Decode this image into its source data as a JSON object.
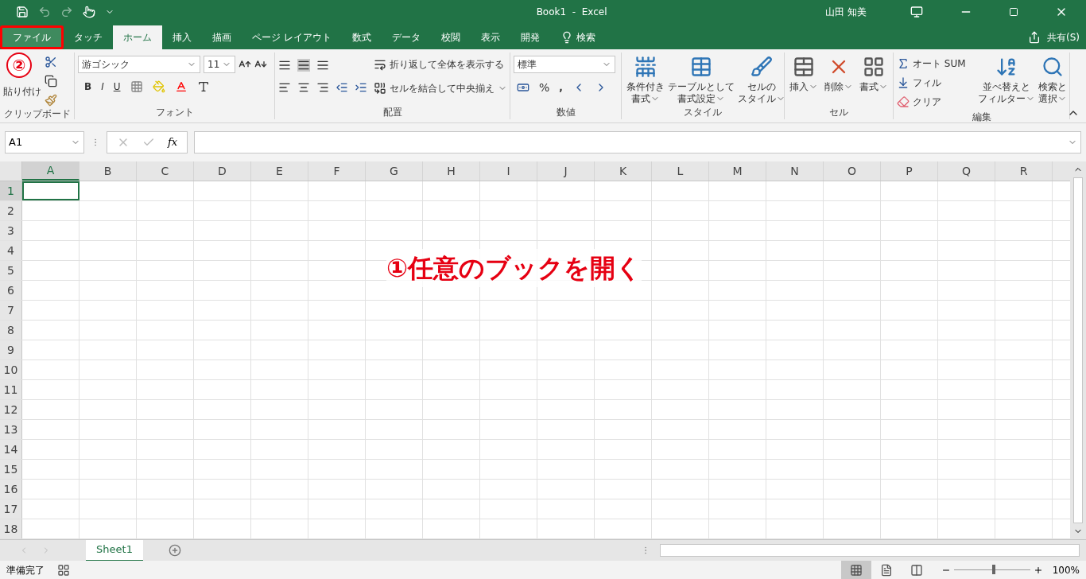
{
  "window": {
    "title": "Book1  -  Excel",
    "user": "山田 知美"
  },
  "tabs": [
    {
      "label": "ファイル",
      "selected": false,
      "highlighted": true
    },
    {
      "label": "タッチ",
      "selected": false,
      "highlighted": false
    },
    {
      "label": "ホーム",
      "selected": true,
      "highlighted": false
    },
    {
      "label": "挿入",
      "selected": false,
      "highlighted": false
    },
    {
      "label": "描画",
      "selected": false,
      "highlighted": false
    },
    {
      "label": "ページ レイアウト",
      "selected": false,
      "highlighted": false
    },
    {
      "label": "数式",
      "selected": false,
      "highlighted": false
    },
    {
      "label": "データ",
      "selected": false,
      "highlighted": false
    },
    {
      "label": "校閲",
      "selected": false,
      "highlighted": false
    },
    {
      "label": "表示",
      "selected": false,
      "highlighted": false
    },
    {
      "label": "開発",
      "selected": false,
      "highlighted": false
    },
    {
      "label": "検索",
      "selected": false,
      "highlighted": false,
      "kind": "search"
    }
  ],
  "share": "共有(S)",
  "clipboard": {
    "label": "クリップボード",
    "paste": "貼り付け"
  },
  "font": {
    "label": "フォント",
    "font_name": "游ゴシック",
    "font_size": "11",
    "bold": "B",
    "italic": "I",
    "underline": "U"
  },
  "alignment": {
    "label": "配置",
    "wrap": "折り返して全体を表示する",
    "merge": "セルを結合して中央揃え"
  },
  "number": {
    "label": "数値",
    "format": "標準",
    "percent": "%",
    "comma": ","
  },
  "styles": {
    "label": "スタイル",
    "buttons": [
      [
        "条件付き",
        "書式"
      ],
      [
        "テーブルとして",
        "書式設定"
      ],
      [
        "セルの",
        "スタイル"
      ]
    ]
  },
  "cells": {
    "label": "セル",
    "buttons": [
      "挿入",
      "削除",
      "書式"
    ]
  },
  "editing": {
    "label": "編集",
    "items": [
      "オート SUM",
      "フィル",
      "クリア"
    ],
    "buttons": [
      [
        "並べ替えと",
        "フィルター"
      ],
      [
        "検索と",
        "選択"
      ]
    ]
  },
  "formula_bar": {
    "name_box": "A1",
    "function_label": "fx"
  },
  "grid": {
    "columns": [
      {
        "label": "A",
        "selected": true
      },
      {
        "label": "B",
        "selected": false
      },
      {
        "label": "C",
        "selected": false
      },
      {
        "label": "D",
        "selected": false
      },
      {
        "label": "E",
        "selected": false
      },
      {
        "label": "F",
        "selected": false
      },
      {
        "label": "G",
        "selected": false
      },
      {
        "label": "H",
        "selected": false
      },
      {
        "label": "I",
        "selected": false
      },
      {
        "label": "J",
        "selected": false
      },
      {
        "label": "K",
        "selected": false
      },
      {
        "label": "L",
        "selected": false
      },
      {
        "label": "M",
        "selected": false
      },
      {
        "label": "N",
        "selected": false
      },
      {
        "label": "O",
        "selected": false
      },
      {
        "label": "P",
        "selected": false
      },
      {
        "label": "Q",
        "selected": false
      },
      {
        "label": "R",
        "selected": false
      }
    ],
    "rows": [
      {
        "label": "1",
        "selected": true
      },
      {
        "label": "2",
        "selected": false
      },
      {
        "label": "3",
        "selected": false
      },
      {
        "label": "4",
        "selected": false
      },
      {
        "label": "5",
        "selected": false
      },
      {
        "label": "6",
        "selected": false
      },
      {
        "label": "7",
        "selected": false
      },
      {
        "label": "8",
        "selected": false
      },
      {
        "label": "9",
        "selected": false
      },
      {
        "label": "10",
        "selected": false
      },
      {
        "label": "11",
        "selected": false
      },
      {
        "label": "12",
        "selected": false
      },
      {
        "label": "13",
        "selected": false
      },
      {
        "label": "14",
        "selected": false
      },
      {
        "label": "15",
        "selected": false
      },
      {
        "label": "16",
        "selected": false
      },
      {
        "label": "17",
        "selected": false
      },
      {
        "label": "18",
        "selected": false
      }
    ]
  },
  "sheets": [
    {
      "label": "Sheet1",
      "selected": true
    }
  ],
  "status_bar": {
    "status": "準備完了",
    "views": [
      {
        "kind": "normal",
        "selected": true
      },
      {
        "kind": "page_layout",
        "selected": false
      },
      {
        "kind": "page_break",
        "selected": false
      }
    ],
    "zoom": {
      "level": 0.5,
      "reading": "100%"
    }
  },
  "callouts": [
    {
      "kind": "circle",
      "label": "②"
    },
    {
      "kind": "caption",
      "label": "①任意のブックを開く"
    }
  ]
}
